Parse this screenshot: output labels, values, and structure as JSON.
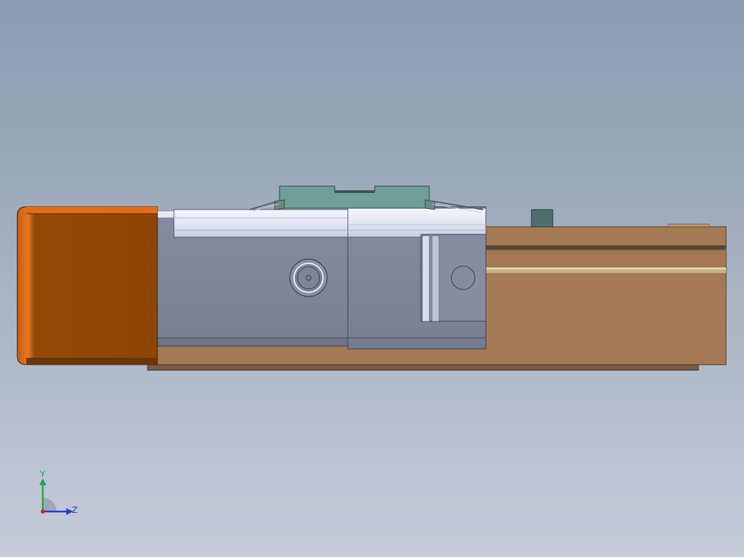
{
  "viewport": {
    "background_top": "#8b9bb0",
    "background_bottom": "#c6ccd8"
  },
  "model": {
    "parts": [
      {
        "name": "motor-housing",
        "color": "#924808",
        "accent": "#e07018"
      },
      {
        "name": "base-rail",
        "color": "#a07850",
        "edge": "#5a4030"
      },
      {
        "name": "carriage",
        "color": "#7e849a",
        "highlight": "#e8ecf8"
      },
      {
        "name": "top-bracket",
        "color": "#6f9e96"
      },
      {
        "name": "stop-block",
        "color": "#4a6e6c"
      }
    ]
  },
  "triad": {
    "x_label": "Z",
    "y_label": "Y",
    "y_color": "#1fa64a",
    "z_color": "#2040d0",
    "origin_color": "#d02020"
  }
}
